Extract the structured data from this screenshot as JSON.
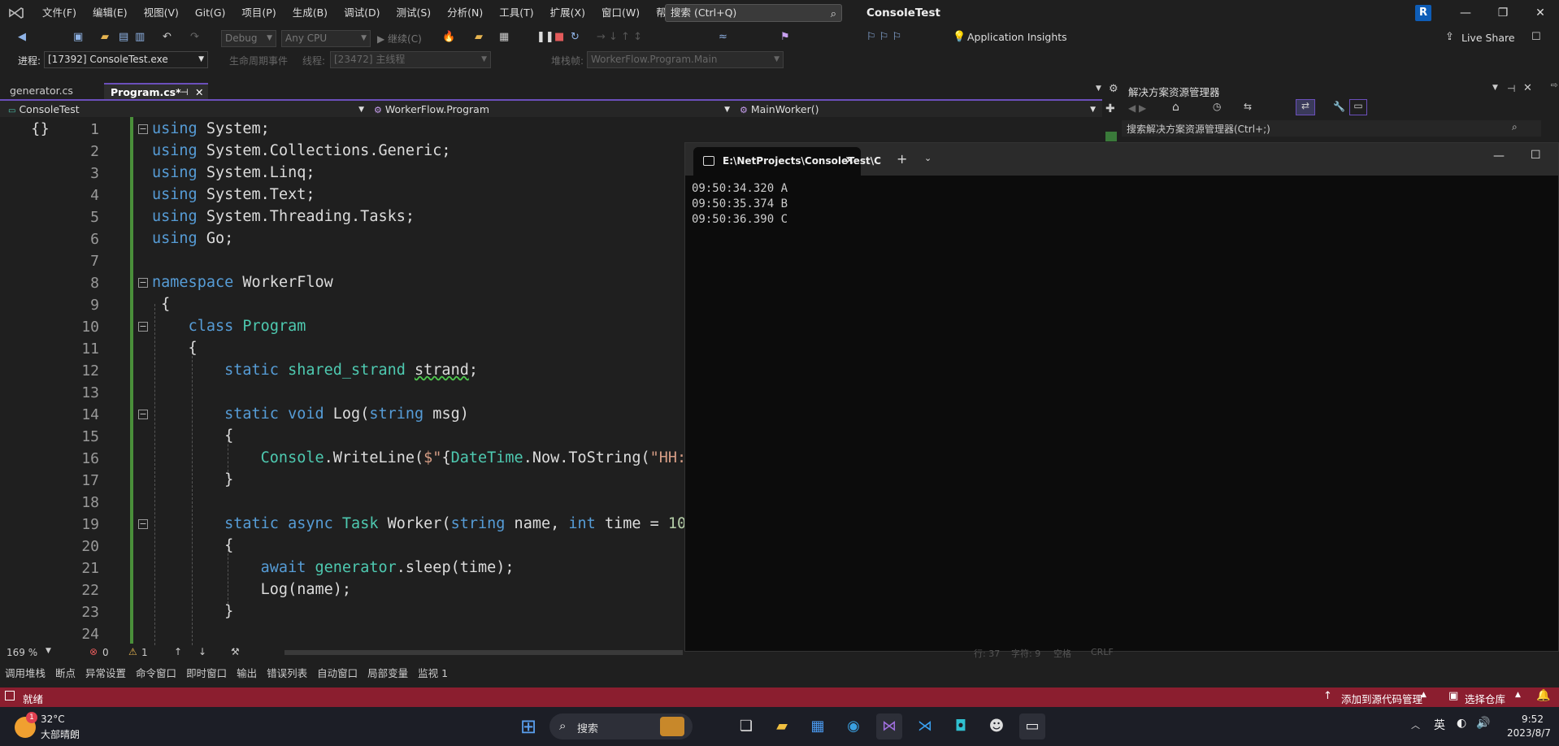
{
  "menu": {
    "items": [
      "文件(F)",
      "编辑(E)",
      "视图(V)",
      "Git(G)",
      "项目(P)",
      "生成(B)",
      "调试(D)",
      "测试(S)",
      "分析(N)",
      "工具(T)",
      "扩展(X)",
      "窗口(W)",
      "帮助(H)"
    ],
    "search_placeholder": "搜索 (Ctrl+Q)",
    "app_title": "ConsoleTest",
    "avatar": "R"
  },
  "toolbar": {
    "config": "Debug",
    "platform": "Any CPU",
    "continue": "▶ 继续(C)",
    "app_insights": "Application Insights",
    "live_share": "Live Share"
  },
  "debugbar": {
    "process_label": "进程:",
    "process": "[17392] ConsoleTest.exe",
    "lifecycle": "生命周期事件",
    "thread_label": "线程:",
    "thread": "[23472] 主线程",
    "stack_label": "堆栈帧:",
    "stack": "WorkerFlow.Program.Main"
  },
  "tabs": [
    {
      "label": "generator.cs"
    },
    {
      "label": "Program.cs*"
    }
  ],
  "nav": {
    "project": "ConsoleTest",
    "class": "WorkerFlow.Program",
    "member": "MainWorker()"
  },
  "code": {
    "line_numbers": [
      "1",
      "2",
      "3",
      "4",
      "5",
      "6",
      "7",
      "8",
      "9",
      "10",
      "11",
      "12",
      "13",
      "14",
      "15",
      "16",
      "17",
      "18",
      "19",
      "20",
      "21",
      "22",
      "23",
      "24"
    ]
  },
  "solution_explorer": {
    "title": "解决方案资源管理器",
    "search": "搜索解决方案资源管理器(Ctrl+;)"
  },
  "console": {
    "tab_title": "E:\\NetProjects\\ConsoleTest\\C",
    "lines": [
      "09:50:34.320 A",
      "09:50:35.374 B",
      "09:50:36.390 C"
    ]
  },
  "editor_status": {
    "zoom": "169 %",
    "errors": "0",
    "warnings": "1",
    "line": "行: 37",
    "col": "字符: 9",
    "spaces": "空格",
    "eol": "CRLF"
  },
  "tool_windows": [
    "调用堆栈",
    "断点",
    "异常设置",
    "命令窗口",
    "即时窗口",
    "输出",
    "错误列表",
    "自动窗口",
    "局部变量",
    "监视 1"
  ],
  "statusbar": {
    "state": "就绪",
    "add_source": "添加到源代码管理",
    "select_repo": "选择仓库"
  },
  "taskbar": {
    "temp": "32°C",
    "weather": "大部晴朗",
    "weather_badge": "1",
    "search": "搜索",
    "ime": "英",
    "time": "9:52",
    "date": "2023/8/7"
  },
  "colors": {
    "accent_purple": "#6b4fbb",
    "status_red": "#8b1e2f",
    "keyword": "#569cd6",
    "type": "#4ec9b0"
  }
}
